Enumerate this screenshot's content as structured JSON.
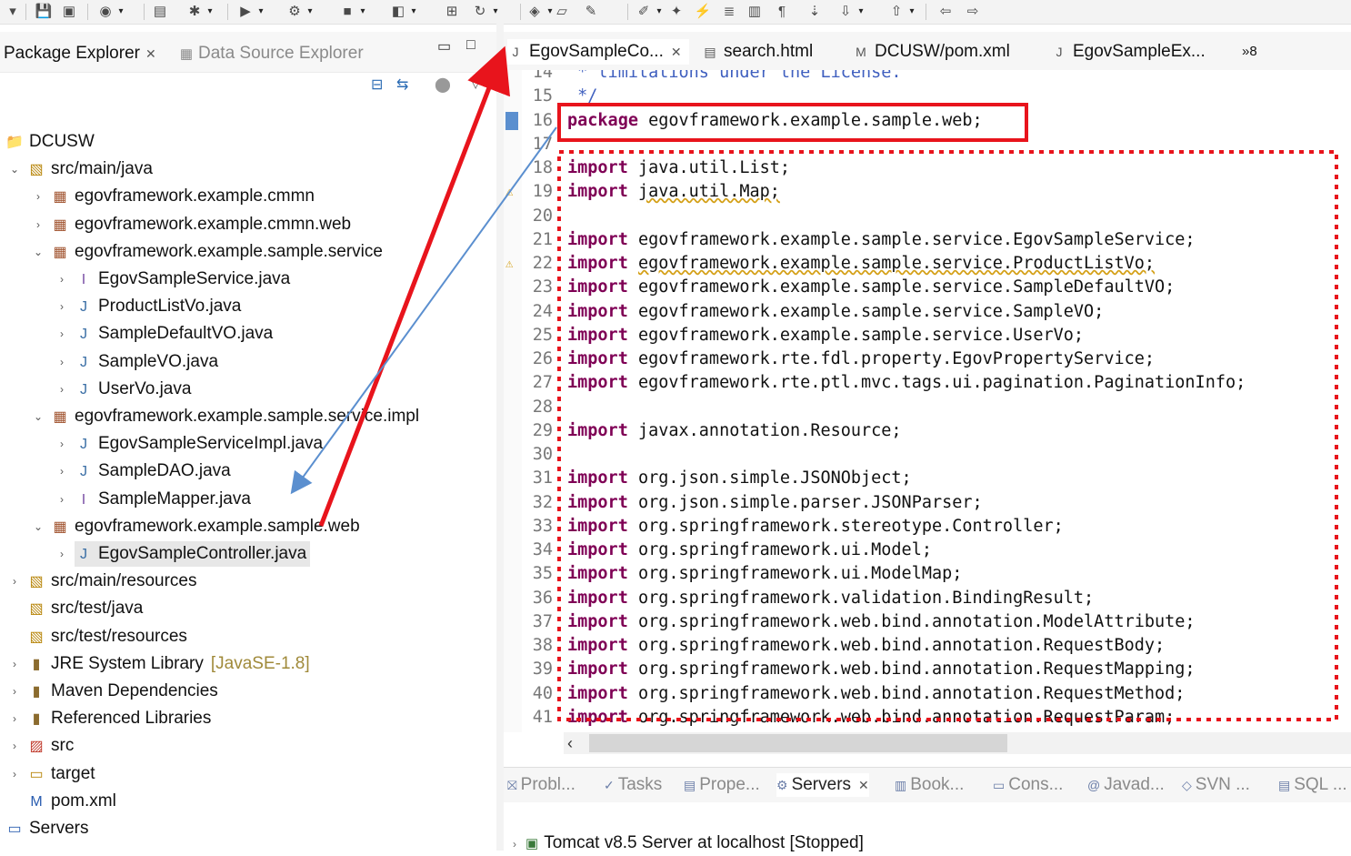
{
  "toolbar": {
    "icons": [
      "dropdown-arrow-icon",
      "save-icon",
      "save-all-icon",
      "debug-profile-icon",
      "console-icon",
      "debug-icon",
      "run-icon",
      "external-tools-icon",
      "stop-icon",
      "terminate-icon",
      "new-package-icon",
      "refresh-icon",
      "open-type-icon",
      "open-folder-icon",
      "search-icon",
      "pen-icon",
      "annotation-icon",
      "highlight-icon",
      "format-icon",
      "document-icon",
      "paragraph-icon",
      "walk-icon",
      "next-annotation-icon",
      "previous-annotation-icon",
      "back-icon",
      "forward-icon"
    ]
  },
  "left_view": {
    "tabs": [
      {
        "label": "Package Explorer",
        "active": true
      },
      {
        "label": "Data Source Explorer",
        "active": false
      }
    ],
    "tree": [
      {
        "label": "DCUSW",
        "level": 0,
        "icon": "project-icon",
        "toggle": ""
      },
      {
        "label": "src/main/java",
        "level": 1,
        "icon": "source-folder-icon",
        "toggle": "expanded"
      },
      {
        "label": "egovframework.example.cmmn",
        "level": 2,
        "icon": "package-icon",
        "toggle": "collapsed"
      },
      {
        "label": "egovframework.example.cmmn.web",
        "level": 2,
        "icon": "package-icon",
        "toggle": "collapsed"
      },
      {
        "label": "egovframework.example.sample.service",
        "level": 2,
        "icon": "package-icon",
        "toggle": "expanded"
      },
      {
        "label": "EgovSampleService.java",
        "level": 3,
        "icon": "java-interface-icon",
        "toggle": "collapsed"
      },
      {
        "label": "ProductListVo.java",
        "level": 3,
        "icon": "java-file-icon",
        "toggle": "collapsed"
      },
      {
        "label": "SampleDefaultVO.java",
        "level": 3,
        "icon": "java-file-icon",
        "toggle": "collapsed"
      },
      {
        "label": "SampleVO.java",
        "level": 3,
        "icon": "java-file-icon",
        "toggle": "collapsed"
      },
      {
        "label": "UserVo.java",
        "level": 3,
        "icon": "java-file-icon",
        "toggle": "collapsed"
      },
      {
        "label": "egovframework.example.sample.service.impl",
        "level": 2,
        "icon": "package-icon",
        "toggle": "expanded"
      },
      {
        "label": "EgovSampleServiceImpl.java",
        "level": 3,
        "icon": "java-file-icon",
        "toggle": "collapsed"
      },
      {
        "label": "SampleDAO.java",
        "level": 3,
        "icon": "java-file-icon",
        "toggle": "collapsed"
      },
      {
        "label": "SampleMapper.java",
        "level": 3,
        "icon": "java-interface-icon",
        "toggle": "collapsed"
      },
      {
        "label": "egovframework.example.sample.web",
        "level": 2,
        "icon": "package-icon",
        "toggle": "expanded"
      },
      {
        "label": "EgovSampleController.java",
        "level": 3,
        "icon": "java-file-icon",
        "toggle": "collapsed",
        "selected": true
      },
      {
        "label": "src/main/resources",
        "level": 1,
        "icon": "source-folder-icon",
        "toggle": "collapsed"
      },
      {
        "label": "src/test/java",
        "level": 1,
        "icon": "source-folder-icon",
        "toggle": ""
      },
      {
        "label": "src/test/resources",
        "level": 1,
        "icon": "source-folder-icon",
        "toggle": ""
      },
      {
        "label": "JRE System Library",
        "decoration": "[JavaSE-1.8]",
        "level": 1,
        "icon": "library-icon",
        "toggle": "collapsed"
      },
      {
        "label": "Maven Dependencies",
        "level": 1,
        "icon": "library-icon",
        "toggle": "collapsed"
      },
      {
        "label": "Referenced Libraries",
        "level": 1,
        "icon": "library-icon",
        "toggle": "collapsed"
      },
      {
        "label": "src",
        "level": 1,
        "icon": "folder-error-icon",
        "toggle": "collapsed"
      },
      {
        "label": "target",
        "level": 1,
        "icon": "folder-icon",
        "toggle": "collapsed"
      },
      {
        "label": "pom.xml",
        "level": 1,
        "icon": "maven-pom-icon",
        "toggle": ""
      },
      {
        "label": "Servers",
        "level": 0,
        "icon": "servers-folder-icon",
        "toggle": ""
      }
    ]
  },
  "editor": {
    "tabs": [
      {
        "label": "EgovSampleCo...",
        "icon": "java-file-icon",
        "active": true,
        "closable": true
      },
      {
        "label": "search.html",
        "icon": "html-file-icon",
        "active": false
      },
      {
        "label": "DCUSW/pom.xml",
        "icon": "maven-pom-icon",
        "active": false
      },
      {
        "label": "EgovSampleEx...",
        "icon": "java-file-icon",
        "active": false
      }
    ],
    "overflow_label": "»8",
    "lines": [
      {
        "n": "14",
        "kind": "comment",
        "text": " * limitations under the License."
      },
      {
        "n": "15",
        "kind": "comment",
        "text": " */"
      },
      {
        "n": "16",
        "kind": "package",
        "keyword": "package",
        "text": "egovframework.example.sample.web;"
      },
      {
        "n": "17",
        "kind": "blank",
        "text": ""
      },
      {
        "n": "18",
        "kind": "import",
        "keyword": "import",
        "text": "java.util.List;"
      },
      {
        "n": "19",
        "kind": "import",
        "keyword": "import",
        "text": "java.util.Map;",
        "warning": true
      },
      {
        "n": "20",
        "kind": "blank",
        "text": ""
      },
      {
        "n": "21",
        "kind": "import",
        "keyword": "import",
        "text": "egovframework.example.sample.service.EgovSampleService;"
      },
      {
        "n": "22",
        "kind": "import",
        "keyword": "import",
        "text": "egovframework.example.sample.service.ProductListVo;",
        "warning": true
      },
      {
        "n": "23",
        "kind": "import",
        "keyword": "import",
        "text": "egovframework.example.sample.service.SampleDefaultVO;"
      },
      {
        "n": "24",
        "kind": "import",
        "keyword": "import",
        "text": "egovframework.example.sample.service.SampleVO;"
      },
      {
        "n": "25",
        "kind": "import",
        "keyword": "import",
        "text": "egovframework.example.sample.service.UserVo;"
      },
      {
        "n": "26",
        "kind": "import",
        "keyword": "import",
        "text": "egovframework.rte.fdl.property.EgovPropertyService;"
      },
      {
        "n": "27",
        "kind": "import",
        "keyword": "import",
        "text": "egovframework.rte.ptl.mvc.tags.ui.pagination.PaginationInfo;"
      },
      {
        "n": "28",
        "kind": "blank",
        "text": ""
      },
      {
        "n": "29",
        "kind": "import",
        "keyword": "import",
        "text": "javax.annotation.Resource;"
      },
      {
        "n": "30",
        "kind": "blank",
        "text": ""
      },
      {
        "n": "31",
        "kind": "import",
        "keyword": "import",
        "text": "org.json.simple.JSONObject;"
      },
      {
        "n": "32",
        "kind": "import",
        "keyword": "import",
        "text": "org.json.simple.parser.JSONParser;"
      },
      {
        "n": "33",
        "kind": "import",
        "keyword": "import",
        "text": "org.springframework.stereotype.Controller;"
      },
      {
        "n": "34",
        "kind": "import",
        "keyword": "import",
        "text": "org.springframework.ui.Model;"
      },
      {
        "n": "35",
        "kind": "import",
        "keyword": "import",
        "text": "org.springframework.ui.ModelMap;"
      },
      {
        "n": "36",
        "kind": "import",
        "keyword": "import",
        "text": "org.springframework.validation.BindingResult;"
      },
      {
        "n": "37",
        "kind": "import",
        "keyword": "import",
        "text": "org.springframework.web.bind.annotation.ModelAttribute;"
      },
      {
        "n": "38",
        "kind": "import",
        "keyword": "import",
        "text": "org.springframework.web.bind.annotation.RequestBody;"
      },
      {
        "n": "39",
        "kind": "import",
        "keyword": "import",
        "text": "org.springframework.web.bind.annotation.RequestMapping;"
      },
      {
        "n": "40",
        "kind": "import",
        "keyword": "import",
        "text": "org.springframework.web.bind.annotation.RequestMethod;"
      },
      {
        "n": "41",
        "kind": "import",
        "keyword": "import",
        "text": "org.springframework.web.bind.annotation.RequestParam;"
      }
    ]
  },
  "bottom_panel": {
    "tabs": [
      {
        "label": "Probl...",
        "icon": "problems-icon"
      },
      {
        "label": "Tasks",
        "icon": "tasks-icon"
      },
      {
        "label": "Prope...",
        "icon": "properties-icon"
      },
      {
        "label": "Servers",
        "icon": "servers-icon",
        "active": true,
        "closable": true
      },
      {
        "label": "Book...",
        "icon": "bookmarks-icon"
      },
      {
        "label": "Cons...",
        "icon": "console-icon"
      },
      {
        "label": "Javad...",
        "icon": "javadoc-icon"
      },
      {
        "label": "SVN ...",
        "icon": "svn-icon"
      },
      {
        "label": "SQL ...",
        "icon": "sql-icon"
      }
    ],
    "server_entry": "Tomcat v8.5 Server at localhost  [Stopped]"
  },
  "colors": {
    "keyword": "#7f0055",
    "comment": "#3f5fbf",
    "annotation_red": "#e8141c",
    "annotation_blue": "#5b8fcf",
    "selection": "#e7e7e7"
  }
}
